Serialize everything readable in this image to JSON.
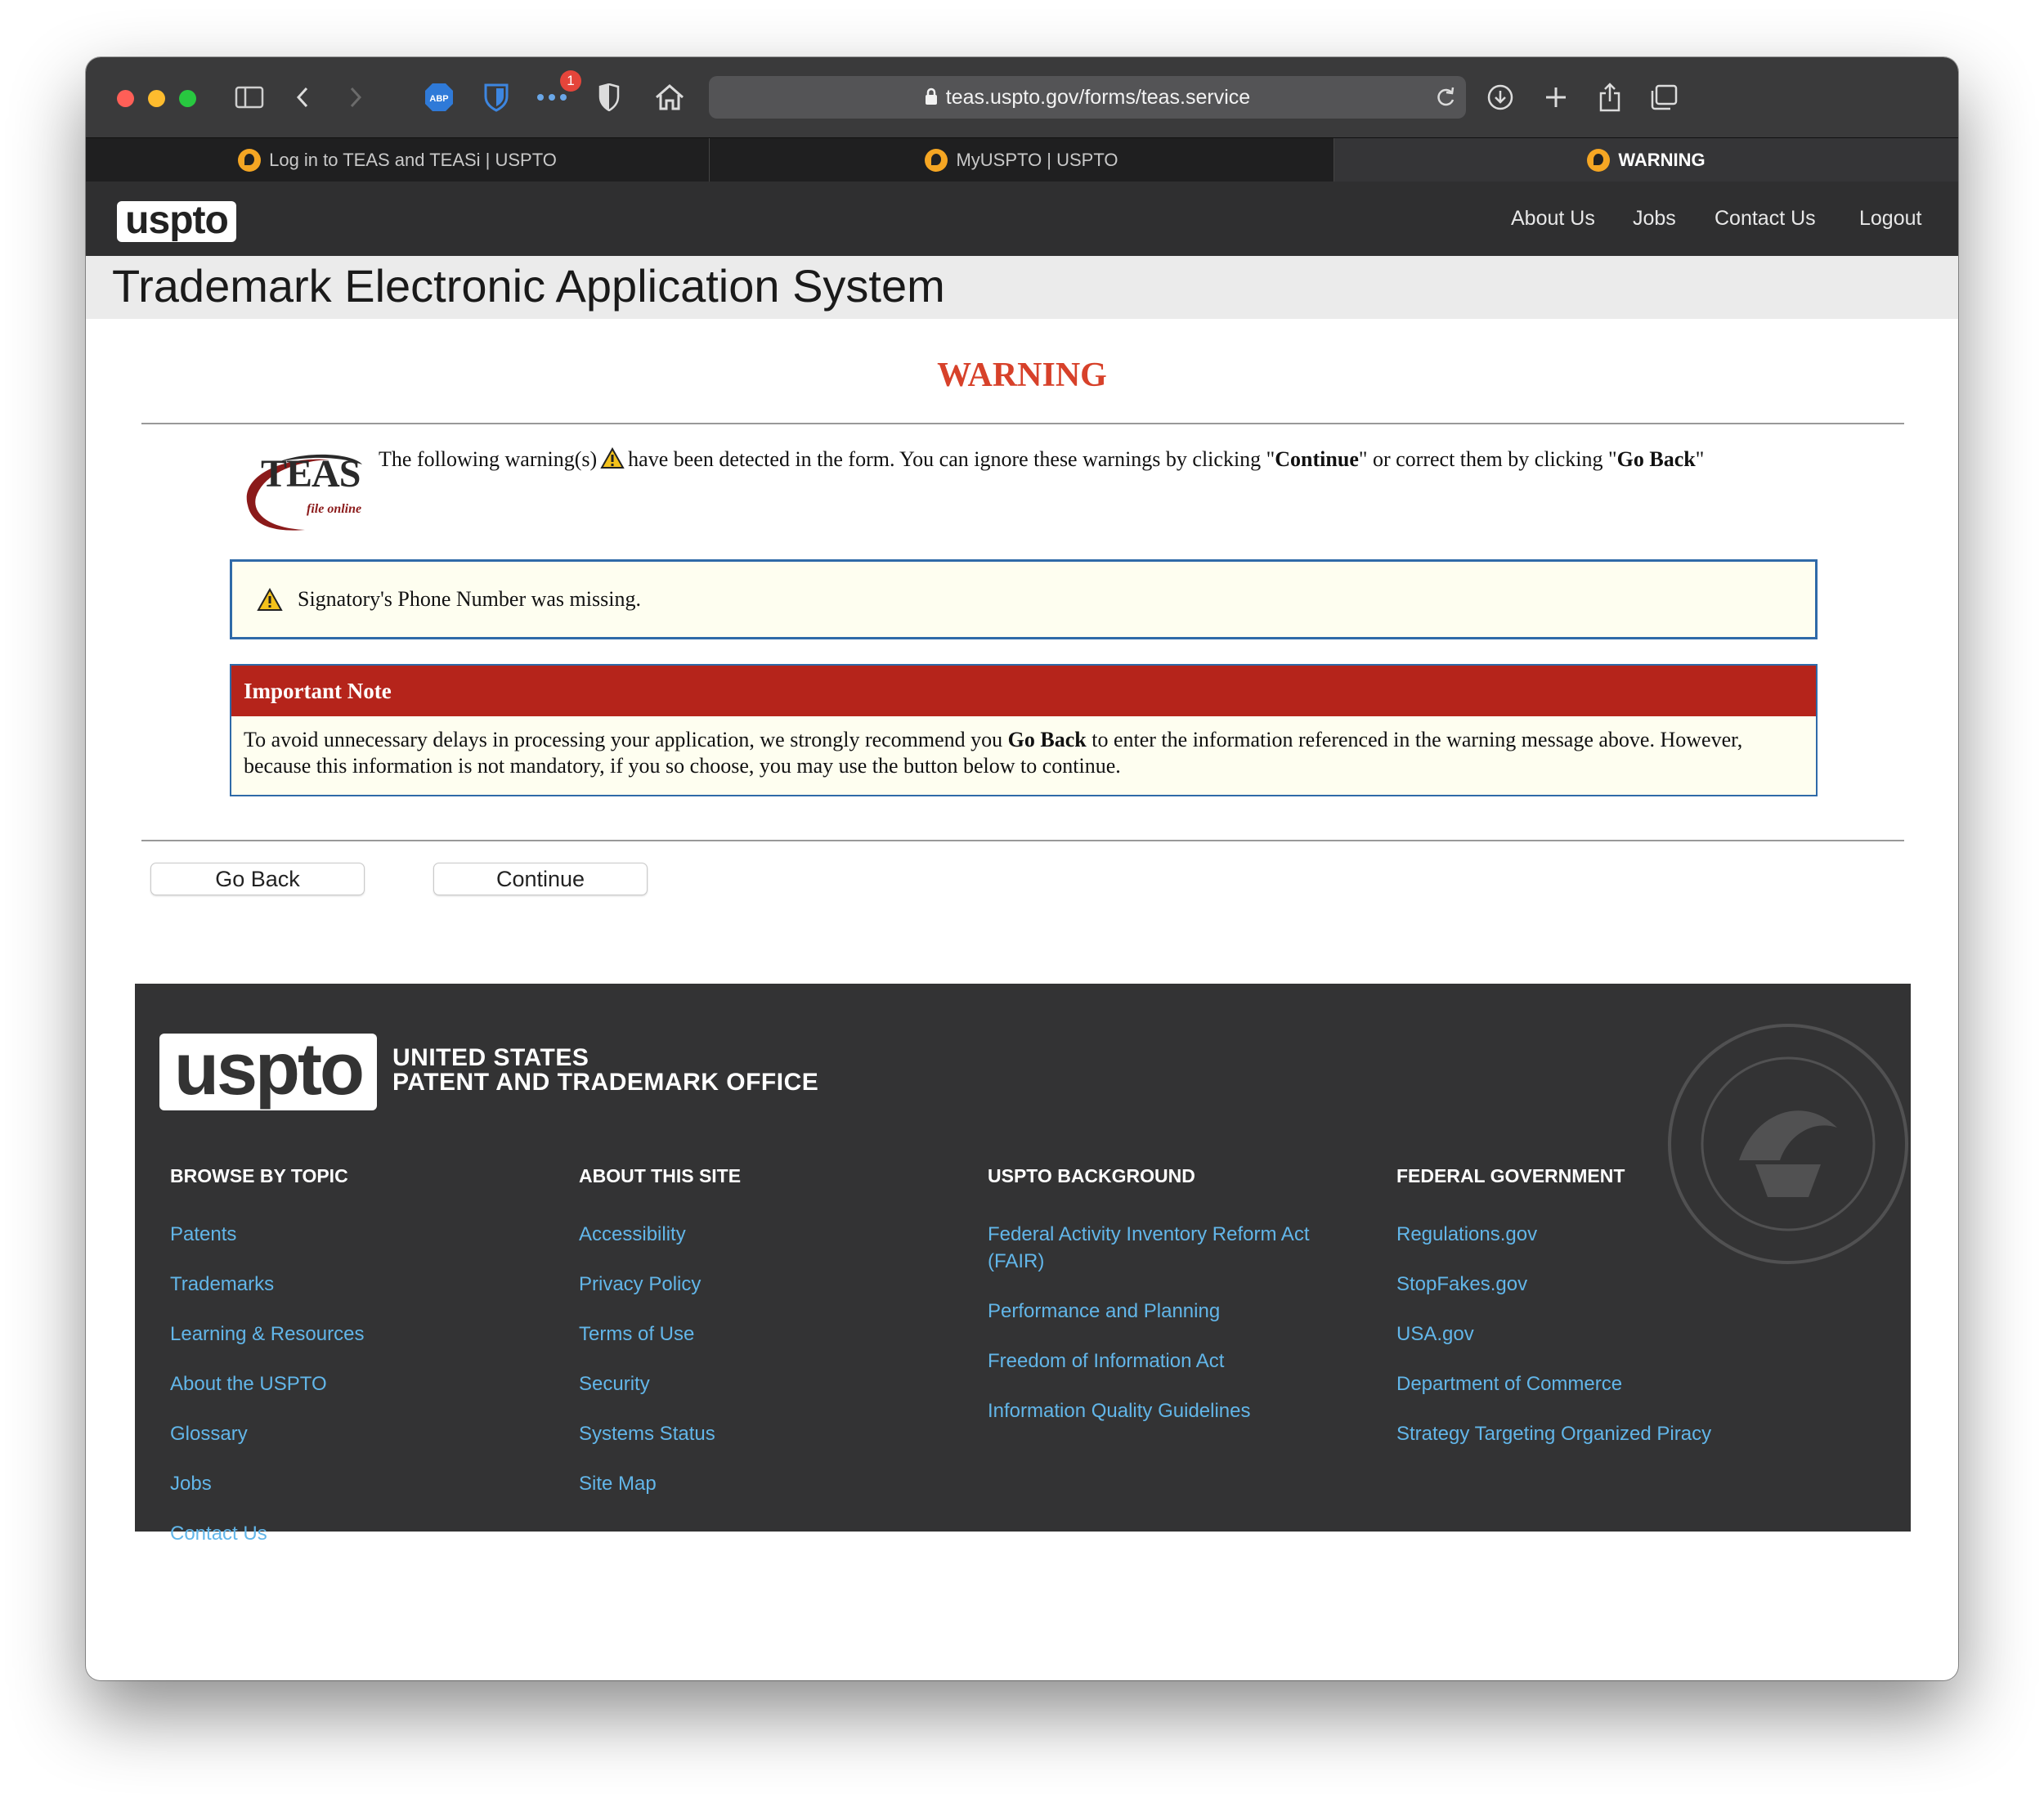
{
  "browser": {
    "url": "teas.uspto.gov/forms/teas.service",
    "notification_count": "1",
    "abp_label": "ABP",
    "tabs": [
      {
        "label": "Log in to TEAS and TEASi | USPTO"
      },
      {
        "label": "MyUSPTO | USPTO"
      },
      {
        "label": "WARNING"
      }
    ]
  },
  "site": {
    "logo": "uspto",
    "nav": [
      "About Us",
      "Jobs",
      "Contact Us",
      "Logout"
    ],
    "app_title": "Trademark Electronic Application System"
  },
  "warning": {
    "heading": "WARNING",
    "intro_1": "The following warning(s)",
    "intro_2": "have been detected in the form. You can ignore these warnings by clicking \"",
    "intro_continue": "Continue",
    "intro_3": "\" or correct them by clicking \"",
    "intro_goback": "Go Back",
    "intro_4": "\"",
    "teas_logo_text": "TEAS",
    "teas_logo_sub": "file online",
    "message": "Signatory's Phone Number was missing."
  },
  "note": {
    "title": "Important Note",
    "body_1": "To avoid unnecessary delays in processing your application, we strongly recommend you",
    "body_bold": "Go Back",
    "body_2": "to enter the information referenced in the warning message above. However, because this information is not mandatory, if you so choose, you may use the button below to continue."
  },
  "buttons": {
    "go_back": "Go Back",
    "continue": "Continue"
  },
  "footer": {
    "logo": "uspto",
    "agency_line1": "UNITED STATES",
    "agency_line2": "PATENT AND TRADEMARK OFFICE",
    "columns": [
      {
        "title": "BROWSE BY TOPIC",
        "links": [
          "Patents",
          "Trademarks",
          "Learning & Resources",
          "About the USPTO",
          "Glossary",
          "Jobs",
          "Contact Us"
        ]
      },
      {
        "title": "ABOUT THIS SITE",
        "links": [
          "Accessibility",
          "Privacy Policy",
          "Terms of Use",
          "Security",
          "Systems Status",
          "Site Map"
        ]
      },
      {
        "title": "USPTO BACKGROUND",
        "links": [
          "Federal Activity Inventory Reform Act (FAIR)",
          "Performance and Planning",
          "Freedom of Information Act",
          "Information Quality Guidelines"
        ]
      },
      {
        "title": "FEDERAL GOVERNMENT",
        "links": [
          "Regulations.gov",
          "StopFakes.gov",
          "USA.gov",
          "Department of Commerce",
          "Strategy Targeting Organized Piracy"
        ]
      }
    ]
  },
  "colors": {
    "warning_red": "#d7412a",
    "note_header": "#b5241b",
    "box_border": "#2f6aa8",
    "footer_link": "#62b6e9"
  }
}
